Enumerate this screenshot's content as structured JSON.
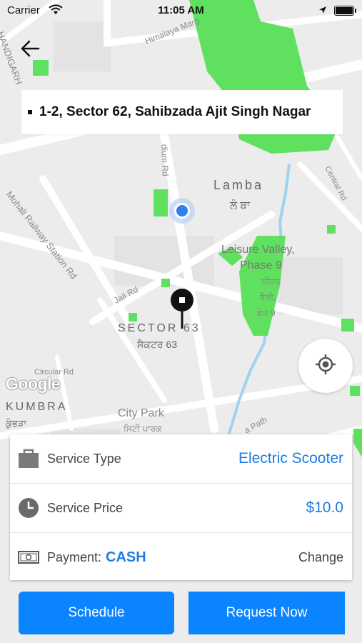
{
  "status_bar": {
    "carrier": "Carrier",
    "time": "11:05 AM"
  },
  "search": {
    "address": "1-2, Sector 62, Sahibzada Ajit Singh Nagar"
  },
  "map": {
    "labels": [
      {
        "key": "chandigarh",
        "text": "HANDIGARH"
      },
      {
        "key": "himalaya",
        "text": "Himalaya Marg"
      },
      {
        "key": "stadium",
        "text": "dium Rd"
      },
      {
        "key": "lamba",
        "text": "Lamba"
      },
      {
        "key": "lamba_pa",
        "text": "ਲੰ ਬਾ"
      },
      {
        "key": "central",
        "text": "Central Rd"
      },
      {
        "key": "mohali_rly",
        "text": "Mohali Railway Station Rd"
      },
      {
        "key": "leisure1",
        "text": "Leisure Valley,"
      },
      {
        "key": "leisure2",
        "text": "Phase 9"
      },
      {
        "key": "leisure_pa1",
        "text": "ਲੀਜ਼ਰ"
      },
      {
        "key": "leisure_pa2",
        "text": "ਵੈਲੀ,"
      },
      {
        "key": "leisure_pa3",
        "text": "ਫੇਜ਼ 9"
      },
      {
        "key": "jail",
        "text": "Jail Rd"
      },
      {
        "key": "sector63",
        "text": "SECTOR 63"
      },
      {
        "key": "sector63_pa",
        "text": "ਸੈਕਟਰ 63"
      },
      {
        "key": "circular",
        "text": "Circular Rd"
      },
      {
        "key": "kumbra",
        "text": "KUMBRA"
      },
      {
        "key": "kumbra_pa",
        "text": "ਕੁੰਭੜਾ"
      },
      {
        "key": "citypark",
        "text": "City Park"
      },
      {
        "key": "citypark_pa",
        "text": "ਸਿਟੀ ਪਾਰਕ"
      },
      {
        "key": "path",
        "text": "a Path"
      }
    ],
    "attribution": "Google"
  },
  "details": {
    "service_type_label": "Service Type",
    "service_type_value": "Electric Scooter",
    "service_price_label": "Service Price",
    "service_price_value": "$10.0",
    "payment_label": "Payment:",
    "payment_value": "CASH",
    "change_label": "Change"
  },
  "buttons": {
    "schedule": "Schedule",
    "request": "Request Now"
  },
  "colors": {
    "accent": "#0a84ff",
    "link": "#1e7ddf",
    "park": "#5fe15f",
    "water": "#9fd2f1",
    "map_bg": "#ececec"
  },
  "icons": [
    "wifi-icon",
    "location-arrow-icon",
    "battery-icon",
    "back-arrow-icon",
    "current-location-dot-icon",
    "destination-pin-icon",
    "gps-target-icon",
    "bag-icon",
    "clock-icon",
    "cash-icon"
  ]
}
